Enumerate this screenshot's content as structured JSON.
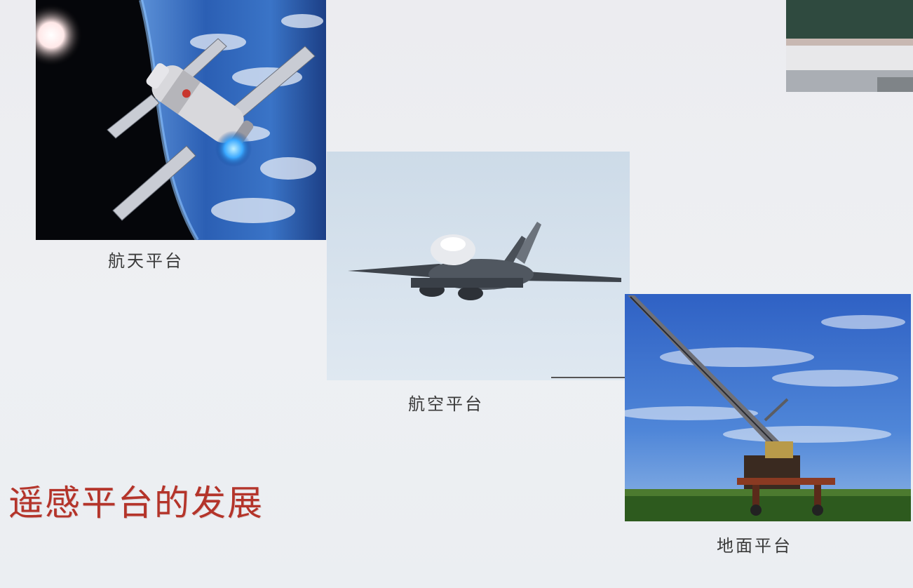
{
  "slide": {
    "title": "遥感平台的发展",
    "photos": [
      {
        "id": "space",
        "caption": "航天平台",
        "subject": "spacecraft-orbiting-earth"
      },
      {
        "id": "air",
        "caption": "航空平台",
        "subject": "fighter-jet-in-flight"
      },
      {
        "id": "ground",
        "caption": "地面平台",
        "subject": "boom-lift-in-field"
      }
    ]
  },
  "colors": {
    "title": "#b4342a",
    "caption": "#3a3a3a",
    "background": "#eceef2"
  }
}
